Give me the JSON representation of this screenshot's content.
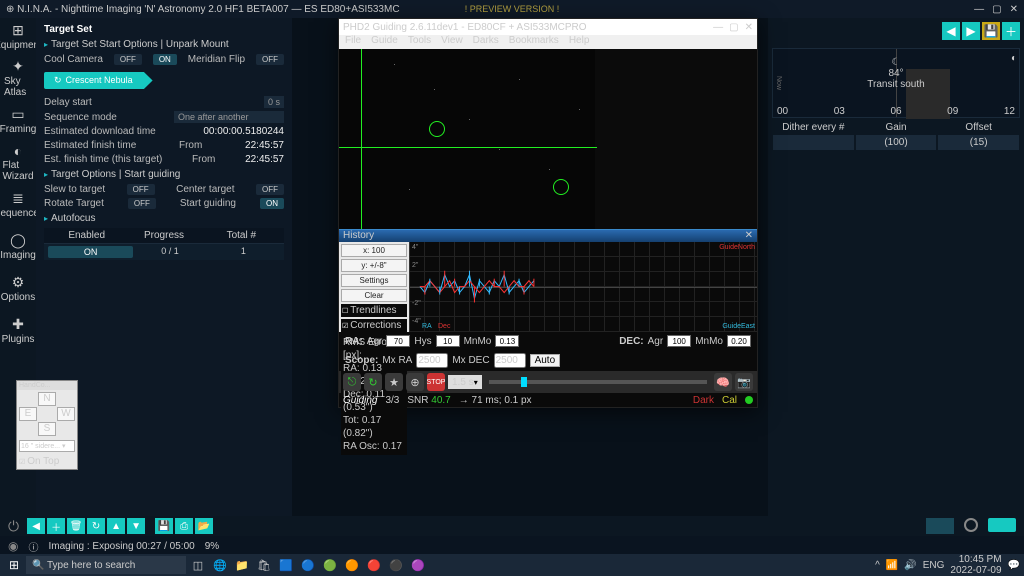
{
  "titlebar": {
    "app": "⊕ N.I.N.A. - Nighttime Imaging 'N' Astronomy 2.0 HF1 BETA007 — ES ED80+ASI533MC",
    "center": "! PREVIEW VERSION !"
  },
  "sidebar": {
    "items": [
      {
        "icon": "⊞",
        "label": "Equipment"
      },
      {
        "icon": "✦",
        "label": "Sky Atlas"
      },
      {
        "icon": "▭",
        "label": "Framing"
      },
      {
        "icon": "◐",
        "label": "Flat Wizard"
      },
      {
        "icon": "≣",
        "label": "Sequencer"
      },
      {
        "icon": "◯",
        "label": "Imaging"
      },
      {
        "icon": "⚙",
        "label": "Options"
      },
      {
        "icon": "✚",
        "label": "Plugins"
      }
    ]
  },
  "panel": {
    "title": "Target Set",
    "sub1": "Target Set Start Options | Unpark Mount",
    "optrow": {
      "cool": "Cool Camera",
      "cool_state": "OFF",
      "unpk": "ON",
      "mf": "Meridian Flip",
      "mf_state": "OFF"
    },
    "target": "Crescent Nebula",
    "rows": [
      {
        "lbl": "Delay start",
        "val": "0  s"
      },
      {
        "lbl": "Sequence mode",
        "val": "One after another"
      },
      {
        "lbl": "Estimated download time",
        "val": "00:00:00.5180244"
      },
      {
        "lbl": "Estimated finish time",
        "pre": "From",
        "val": "22:45:57"
      },
      {
        "lbl": "Est. finish time (this target)",
        "pre": "From",
        "val": "22:45:57"
      }
    ],
    "sub2": "Target Options | Start guiding",
    "trow1": {
      "a": "Slew to target",
      "as": "OFF",
      "b": "Center target",
      "bs": "OFF"
    },
    "trow2": {
      "a": "Rotate Target",
      "as": "OFF",
      "b": "Start guiding",
      "bs": "ON"
    },
    "autofocus": {
      "title": "Autofocus",
      "hdr": [
        "Enabled",
        "Progress",
        "Total #"
      ],
      "row": [
        "ON",
        "0 / 1",
        "1"
      ]
    }
  },
  "right": {
    "transit": {
      "deg": "84°",
      "lbl": "Transit south"
    },
    "ticks": [
      "00",
      "03",
      "06",
      "09",
      "12"
    ],
    "dhdr": [
      "Dither every #",
      "Gain",
      "Offset"
    ],
    "dvals": [
      "",
      "(100)",
      "(15)"
    ]
  },
  "phd2": {
    "title": "PHD2 Guiding 2.6.11dev1 - ED80CF + ASI533MCPRO",
    "menu": [
      "File",
      "Guide",
      "Tools",
      "View",
      "Darks",
      "Bookmarks",
      "Help"
    ],
    "history": {
      "title": "History",
      "ctrl": {
        "x": "x: 100",
        "y": "y: +/-8\"",
        "settings": "Settings",
        "clear": "Clear",
        "trend": "Trendlines",
        "corr": "Corrections"
      },
      "stats": {
        "hdr": "RMS Error [px]:",
        "ra": "RA: 0.13 (0.62\")",
        "dec": "Dec: 0.11 (0.53\")",
        "tot": "Tot: 0.17 (0.82\")",
        "osc": "RA Osc: 0.17"
      },
      "ra_line": [
        0,
        -1,
        1,
        0,
        -1,
        2,
        0,
        1,
        -1,
        0,
        2,
        -2,
        1,
        0,
        -1,
        1,
        0,
        2,
        -1,
        0,
        1,
        -1,
        0,
        1
      ],
      "dec_line": [
        0,
        0,
        1,
        0,
        -1,
        0,
        1,
        -1,
        0,
        0,
        1,
        0,
        -1,
        0,
        1,
        0,
        0,
        -1,
        0,
        1,
        0,
        0,
        1,
        0
      ],
      "corners": {
        "tr": "GuideNorth",
        "br": "GuideEast",
        "bl_ra": "RA",
        "bl_dec": "Dec"
      },
      "ylabels": [
        "4\"",
        "2\"",
        "",
        "-2\"",
        "-4\""
      ]
    },
    "calibration": {
      "ra_lbl": "RA:",
      "agr_lbl": "Agr",
      "agr": "70",
      "hys_lbl": "Hys",
      "hys": "10",
      "mnmo_lbl": "MnMo",
      "mnmo": "0.13",
      "dec_lbl": "DEC:",
      "dagr": "100",
      "dmnmo": "0.20"
    },
    "scope": {
      "lbl": "Scope:",
      "mxra_lbl": "Mx RA",
      "mxra": "2500",
      "mxdec_lbl": "Mx DEC",
      "mxdec": "2500",
      "auto": "Auto"
    },
    "toolbar": {
      "exp": "1.5 s"
    },
    "status": {
      "guiding": "Guiding",
      "frames": "3/3",
      "snr_lbl": "SNR",
      "snr": "40.7",
      "lat": "→  71 ms; 0.1 px",
      "dark": "Dark",
      "cal": "Cal"
    }
  },
  "handcan": {
    "title": "HandCo...",
    "N": "N",
    "S": "S",
    "E": "E",
    "W": "W",
    "mode": "16 \" sidere... ▾",
    "ontop": "On Top"
  },
  "statusline": {
    "imaging": "Imaging : Exposing 00:27 / 05:00",
    "pct": "9%"
  },
  "taskbar": {
    "search": "Type here to search",
    "lang": "ENG",
    "time": "10:45 PM",
    "date": "2022-07-09"
  }
}
